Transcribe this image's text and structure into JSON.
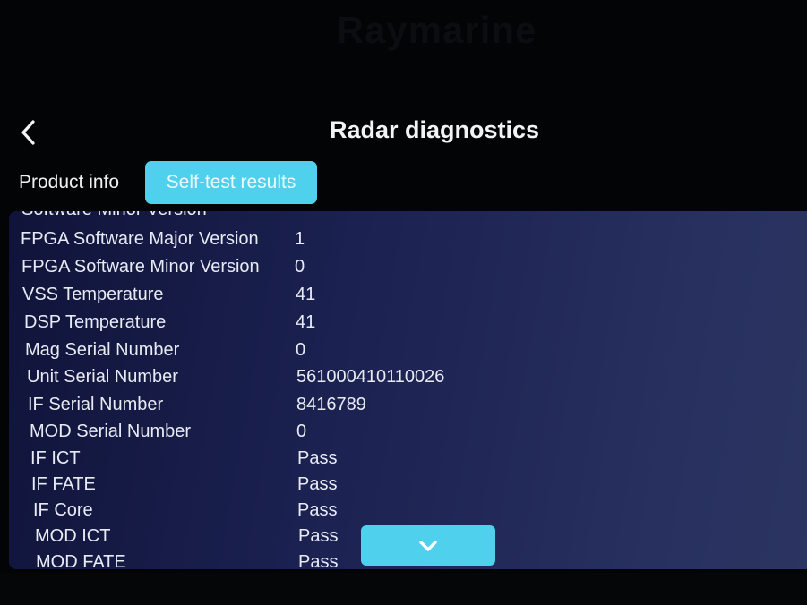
{
  "brand": "Raymarine",
  "header": {
    "title": "Radar diagnostics",
    "back_icon": "chevron-left-icon"
  },
  "tabs": [
    {
      "label": "Product info",
      "active": false
    },
    {
      "label": "Self-test results",
      "active": true
    }
  ],
  "rows": [
    {
      "label": "Software Minor Version",
      "value": "-"
    },
    {
      "label": "FPGA Software Major Version",
      "value": "1"
    },
    {
      "label": "FPGA Software Minor Version",
      "value": "0"
    },
    {
      "label": "VSS Temperature",
      "value": "41"
    },
    {
      "label": "DSP Temperature",
      "value": "41"
    },
    {
      "label": "Mag Serial Number",
      "value": "0"
    },
    {
      "label": "Unit Serial Number",
      "value": "561000410110026"
    },
    {
      "label": "IF Serial Number",
      "value": "8416789"
    },
    {
      "label": "MOD Serial Number",
      "value": "0"
    },
    {
      "label": "IF ICT",
      "value": "Pass"
    },
    {
      "label": "IF FATE",
      "value": "Pass"
    },
    {
      "label": "IF Core",
      "value": "Pass"
    },
    {
      "label": "MOD ICT",
      "value": "Pass"
    },
    {
      "label": "MOD FATE",
      "value": "Pass"
    }
  ],
  "scroll_button": {
    "icon": "chevron-down-icon"
  },
  "colors": {
    "accent": "#4fd0ec",
    "background": "#030405",
    "panel": "#1b2150",
    "text": "#e8ebf3"
  }
}
